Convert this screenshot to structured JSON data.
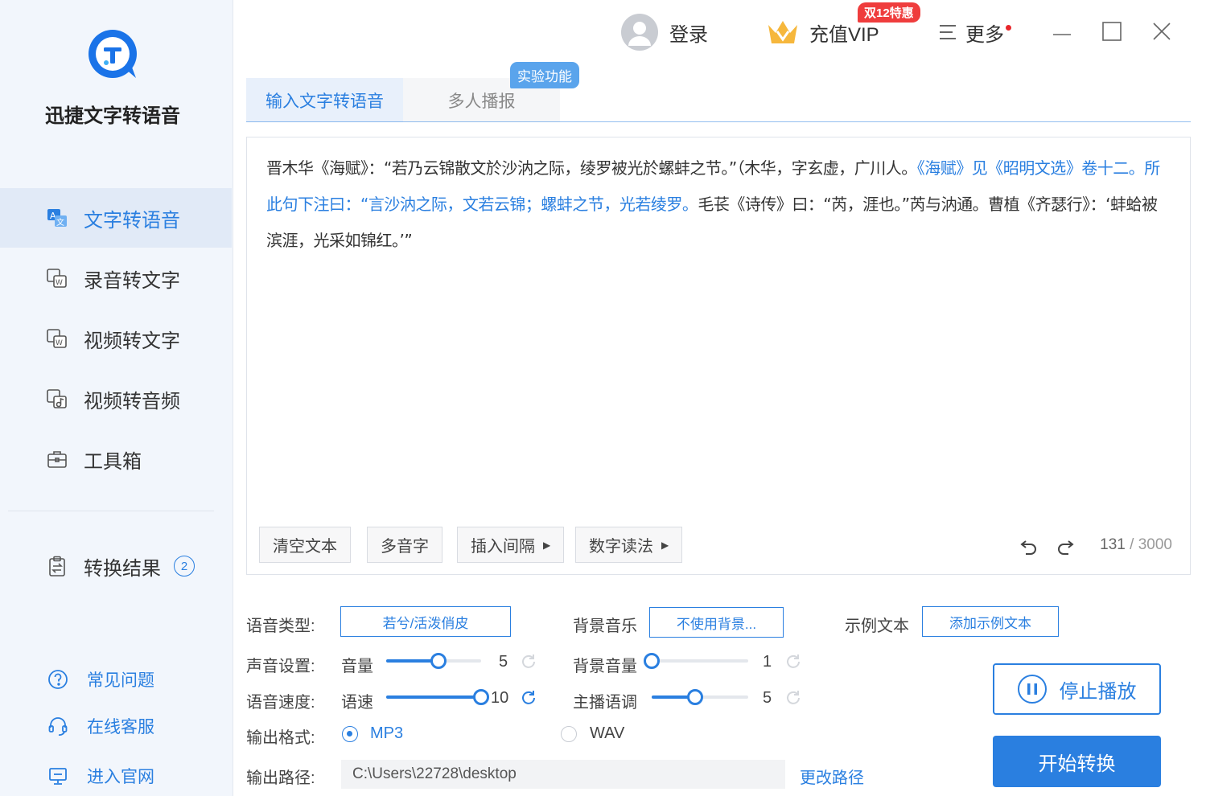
{
  "app": {
    "name": "迅捷文字转语音"
  },
  "topbar": {
    "login": "登录",
    "vip": "充值VIP",
    "promo": "双12特惠",
    "more": "更多"
  },
  "sidebar": {
    "items": [
      {
        "label": "文字转语音",
        "icon": "text-to-speech-icon"
      },
      {
        "label": "录音转文字",
        "icon": "audio-to-text-icon"
      },
      {
        "label": "视频转文字",
        "icon": "video-to-text-icon"
      },
      {
        "label": "视频转音频",
        "icon": "video-to-audio-icon"
      },
      {
        "label": "工具箱",
        "icon": "toolbox-icon"
      }
    ],
    "results": {
      "label": "转换结果",
      "count": "2"
    },
    "help": [
      {
        "label": "常见问题",
        "icon": "question-icon"
      },
      {
        "label": "在线客服",
        "icon": "headset-icon"
      },
      {
        "label": "进入官网",
        "icon": "monitor-icon"
      }
    ]
  },
  "tabs": [
    {
      "label": "输入文字转语音"
    },
    {
      "label": "多人播报"
    }
  ],
  "experimental_badge": "实验功能",
  "editor": {
    "text_parts": [
      {
        "text": "晋木华《海赋》：“若乃云锦散文於沙汭之际，绫罗被光於螺蚌之节。”（木华，字玄虚，广川人。",
        "highlight": false
      },
      {
        "text": "《海赋》见《昭明文选》卷十二。所此句下注曰：“言沙汭之际，文若云锦；螺蚌之节，光若绫罗。",
        "highlight": true
      },
      {
        "text": "毛苌《诗传》曰：“芮，涯也。”芮与汭通。曹植《齐瑟行》：‘蚌蛤被滨涯，光采如锦红。’”",
        "highlight": false
      }
    ],
    "tools": [
      {
        "label": "清空文本",
        "arrow": false
      },
      {
        "label": "多音字",
        "arrow": false
      },
      {
        "label": "插入间隔",
        "arrow": true
      },
      {
        "label": "数字读法",
        "arrow": true
      }
    ],
    "count": "131",
    "max": "3000"
  },
  "settings": {
    "voice_type_label": "语音类型:",
    "voice_type_value": "若兮/活泼俏皮",
    "bg_music_label": "背景音乐",
    "bg_music_value": "不使用背景...",
    "sample_label": "示例文本",
    "sample_button": "添加示例文本",
    "sound_label": "声音设置:",
    "volume_label": "音量",
    "volume_value": "5",
    "volume_fraction": 0.55,
    "bg_volume_label": "背景音量",
    "bg_volume_value": "1",
    "bg_volume_fraction": 0.0,
    "speed_label": "语音速度:",
    "rate_label": "语速",
    "rate_value": "10",
    "rate_fraction": 1.0,
    "pitch_label": "主播语调",
    "pitch_value": "5",
    "pitch_fraction": 0.45,
    "format_label": "输出格式:",
    "formats": [
      "MP3",
      "WAV"
    ],
    "selected_format": "MP3",
    "path_label": "输出路径:",
    "path_value": "C:\\Users\\22728\\desktop",
    "change_path": "更改路径",
    "stop_button": "停止播放",
    "start_button": "开始转换"
  },
  "colors": {
    "accent": "#2a7fe0",
    "promo": "#ef3d3d",
    "vip_gold": "#f6b73c"
  }
}
